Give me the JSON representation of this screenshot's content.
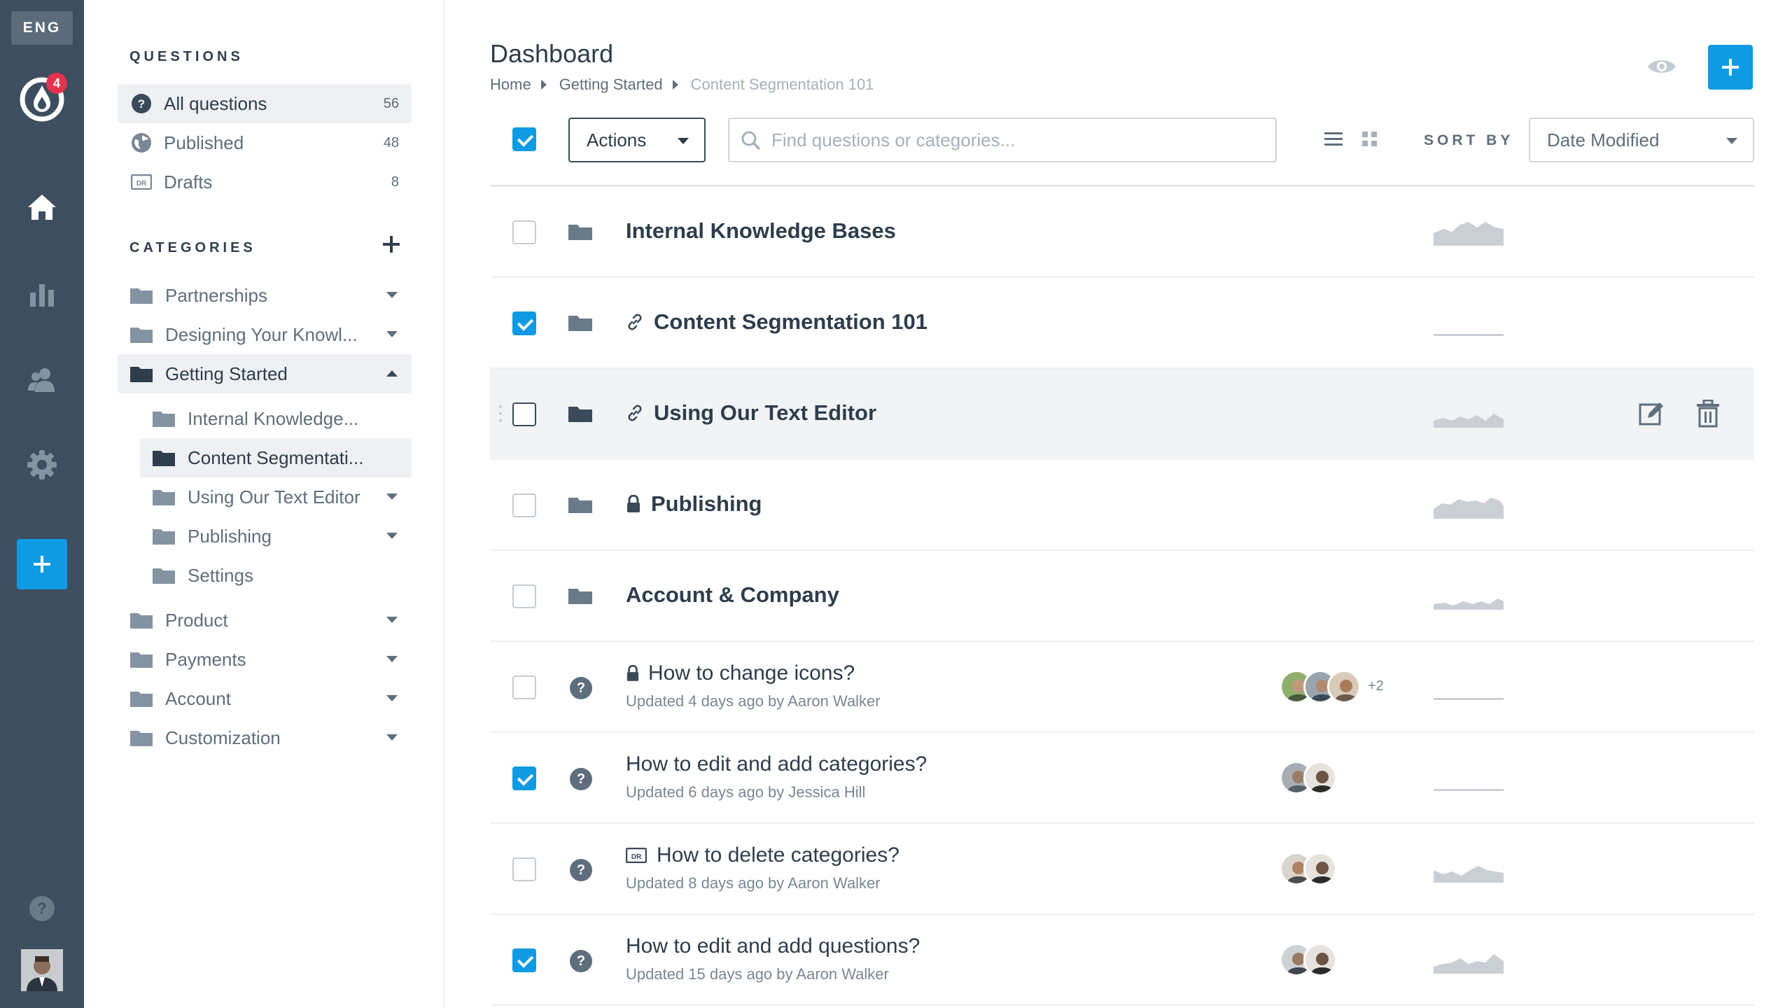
{
  "rail": {
    "lang": "ENG",
    "notifications": "4"
  },
  "sidebar": {
    "questions_heading": "QUESTIONS",
    "questions": [
      {
        "label": "All questions",
        "count": "56"
      },
      {
        "label": "Published",
        "count": "48"
      },
      {
        "label": "Drafts",
        "count": "8"
      }
    ],
    "categories_heading": "CATEGORIES",
    "categories": [
      {
        "label": "Partnerships"
      },
      {
        "label": "Designing Your Knowl..."
      },
      {
        "label": "Getting Started"
      },
      {
        "label": "Internal Knowledge..."
      },
      {
        "label": "Content Segmentati..."
      },
      {
        "label": "Using Our Text Editor"
      },
      {
        "label": "Publishing"
      },
      {
        "label": "Settings"
      },
      {
        "label": "Product"
      },
      {
        "label": "Payments"
      },
      {
        "label": "Account"
      },
      {
        "label": "Customization"
      }
    ]
  },
  "main": {
    "title": "Dashboard",
    "breadcrumbs": [
      "Home",
      "Getting Started",
      "Content Segmentation 101"
    ],
    "toolbar": {
      "actions_label": "Actions",
      "search_placeholder": "Find questions or categories...",
      "sort_by_label": "SORT BY",
      "sort_value": "Date Modified"
    },
    "folders": [
      {
        "title": "Internal Knowledge Bases",
        "checked": false
      },
      {
        "title": "Content Segmentation 101",
        "checked": true,
        "prefix_icon": "link-icon"
      },
      {
        "title": "Using Our Text Editor",
        "checked": false,
        "prefix_icon": "link-icon"
      },
      {
        "title": "Publishing",
        "checked": false,
        "prefix_icon": "lock-icon"
      },
      {
        "title": "Account & Company",
        "checked": false
      }
    ],
    "questions": [
      {
        "title": "How to change icons?",
        "subtitle": "Updated 4 days ago by Aaron Walker",
        "checked": false,
        "prefix_icon": "lock-icon",
        "extra_count": "+2"
      },
      {
        "title": "How to edit and add categories?",
        "subtitle": "Updated 6 days ago by Jessica Hill",
        "checked": true
      },
      {
        "title": "How to delete categories?",
        "subtitle": "Updated 8 days ago by Aaron Walker",
        "checked": false,
        "prefix_icon": "draft-icon"
      },
      {
        "title": "How to edit and add questions?",
        "subtitle": "Updated 15 days ago by Aaron Walker",
        "checked": true
      }
    ]
  },
  "colors": {
    "rail_bg": "#3d4e60",
    "accent": "#0e9be3",
    "badge": "#e5334f",
    "text_dark": "#2e3d4c",
    "text_muted": "#5f6e7c"
  }
}
